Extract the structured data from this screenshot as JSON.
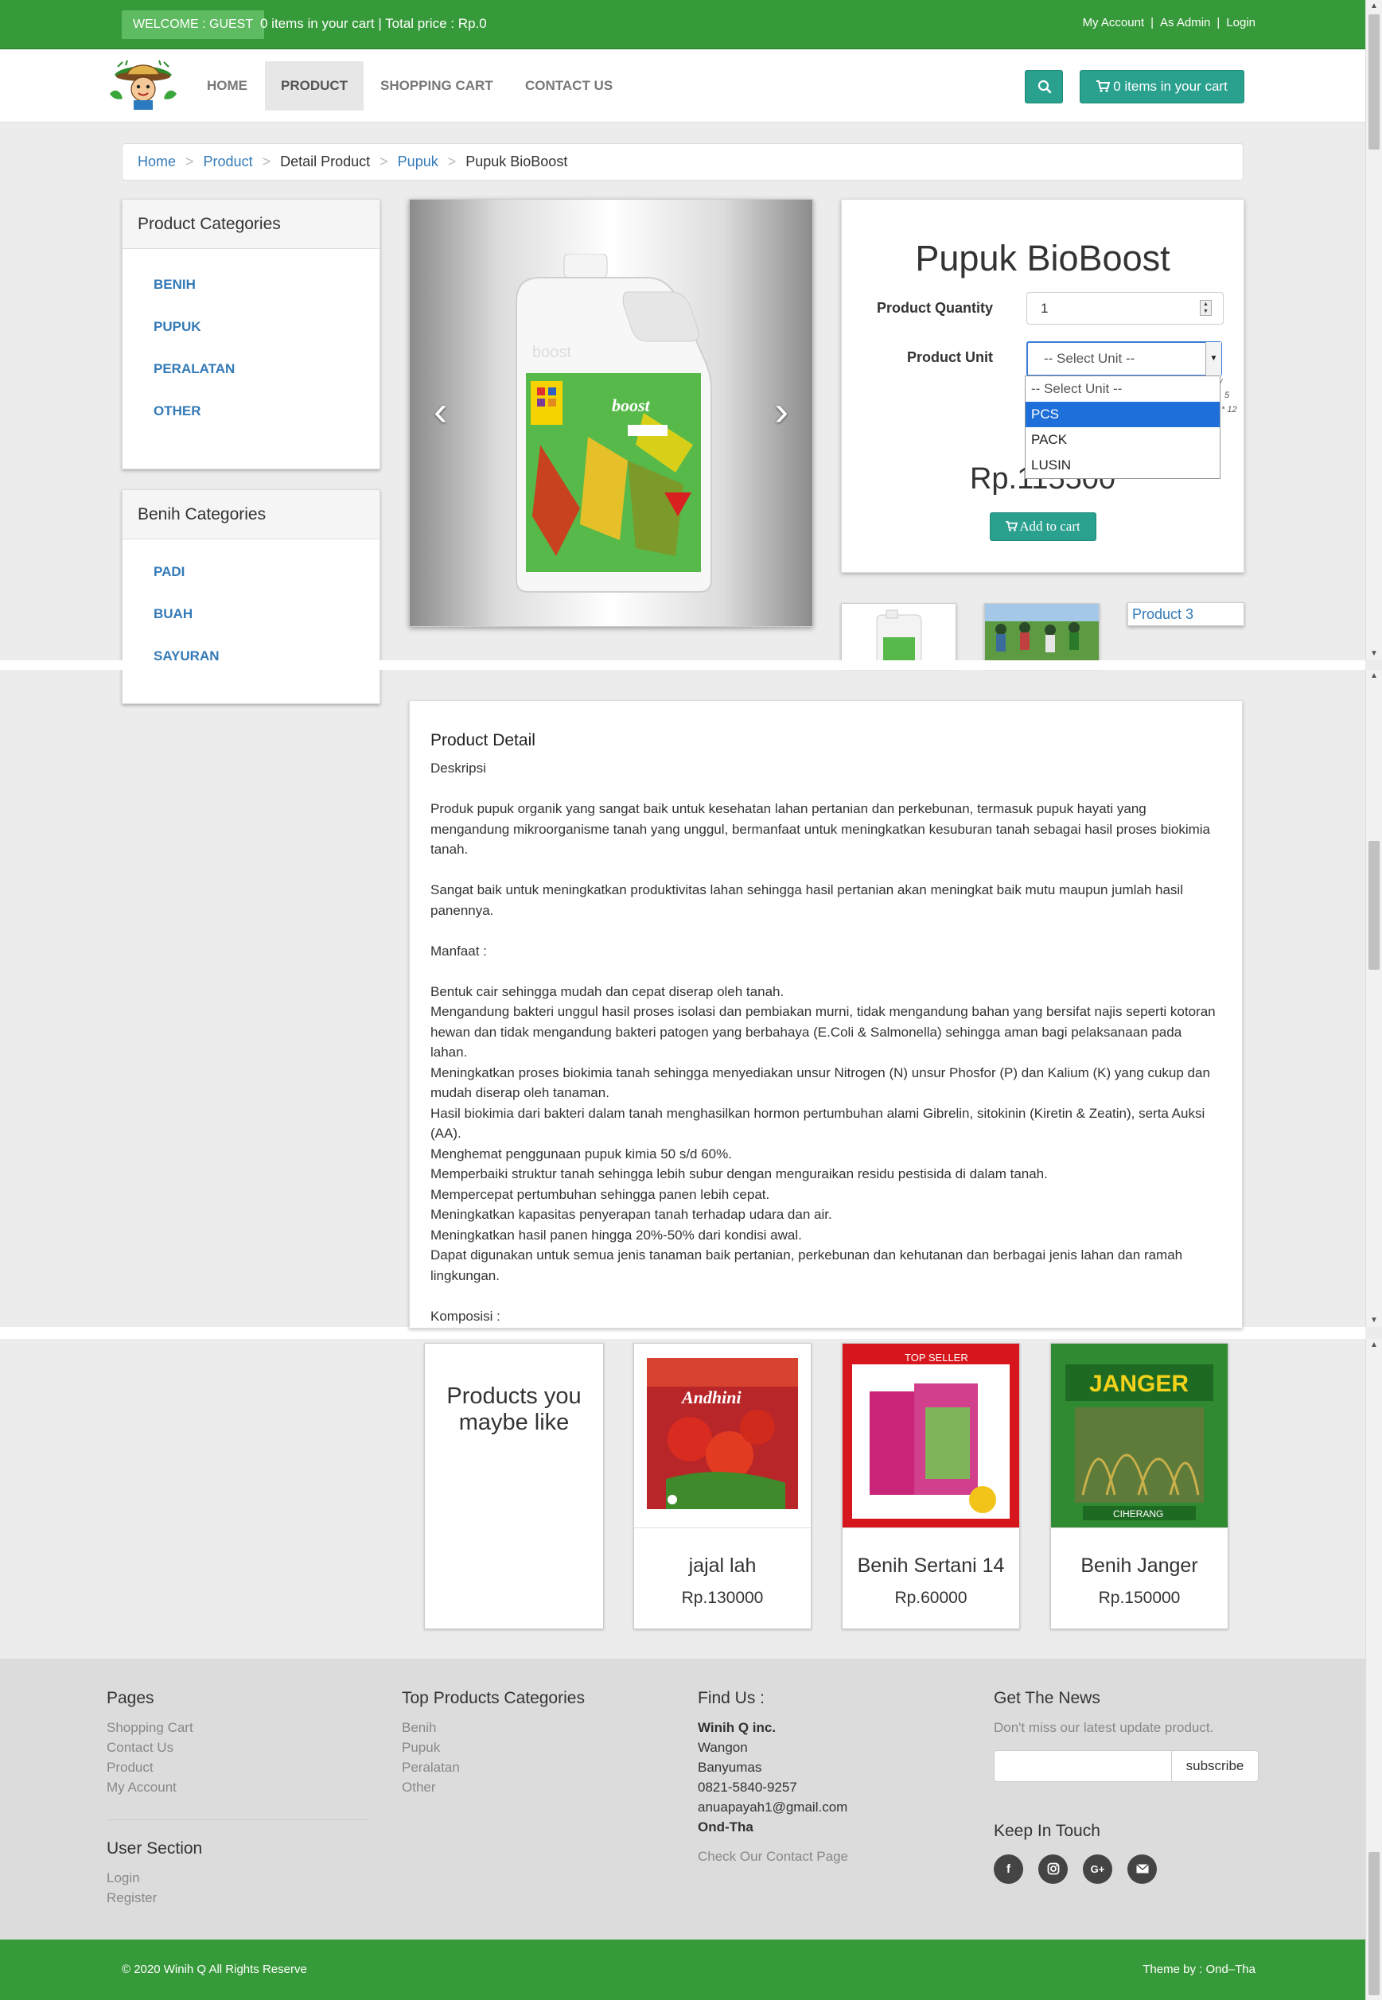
{
  "topbar": {
    "welcome": "WELCOME : GUEST",
    "cart_summary": "0 items in your cart | Total price : Rp.0",
    "links": [
      "My Account",
      "As Admin",
      "Login"
    ]
  },
  "nav": {
    "items": [
      "HOME",
      "PRODUCT",
      "SHOPPING CART",
      "CONTACT US"
    ],
    "active": "PRODUCT",
    "cart_button": "0 items in your cart",
    "search_icon": "search-icon",
    "cart_icon": "cart-icon"
  },
  "breadcrumb": [
    "Home",
    "Product",
    "Detail Product",
    "Pupuk",
    "Pupuk BioBoost"
  ],
  "product_categories": {
    "title": "Product Categories",
    "items": [
      "BENIH",
      "PUPUK",
      "PERALATAN",
      "OTHER"
    ]
  },
  "benih_categories": {
    "title": "Benih Categories",
    "items": [
      "PADI",
      "BUAH",
      "SAYURAN"
    ]
  },
  "product": {
    "name": "Pupuk BioBoost",
    "quantity_label": "Product Quantity",
    "quantity_value": "1",
    "unit_label": "Product Unit",
    "unit_selected": "-- Select Unit --",
    "unit_options": [
      "-- Select Unit --",
      "PCS",
      "PACK",
      "LUSIN"
    ],
    "unit_highlighted": "PCS",
    "price": "Rp.115500",
    "add_to_cart": "Add to cart",
    "thumb3_label": "Product 3"
  },
  "detail": {
    "heading": "Product Detail",
    "body": "Deskripsi\n\nProduk pupuk organik yang sangat baik untuk kesehatan lahan pertanian dan perkebunan, termasuk pupuk hayati yang mengandung mikroorganisme tanah yang unggul, bermanfaat untuk meningkatkan kesuburan tanah sebagai hasil proses biokimia tanah.\n\nSangat baik untuk meningkatkan produktivitas lahan sehingga hasil pertanian akan meningkat baik mutu maupun jumlah hasil panennya.\n\nManfaat :\n\nBentuk cair sehingga mudah dan cepat diserap oleh tanah.\nMengandung bakteri unggul hasil proses isolasi dan pembiakan murni, tidak mengandung bahan yang bersifat najis seperti kotoran hewan dan tidak mengandung bakteri patogen yang berbahaya (E.Coli & Salmonella) sehingga aman bagi pelaksanaan pada lahan.\nMeningkatkan proses biokimia tanah sehingga menyediakan unsur Nitrogen (N) unsur Phosfor (P) dan Kalium (K) yang cukup dan mudah diserap oleh tanaman.\nHasil biokimia dari bakteri dalam tanah menghasilkan hormon pertumbuhan alami Gibrelin, sitokinin (Kiretin & Zeatin), serta Auksi (AA).\nMenghemat penggunaan pupuk kimia 50 s/d 60%.\nMemperbaiki struktur tanah sehingga lebih subur dengan menguraikan residu pestisida di dalam tanah.\nMempercepat pertumbuhan sehingga panen lebih cepat.\nMeningkatkan kapasitas penyerapan tanah terhadap udara dan air.\nMeningkatkan hasil panen hingga 20%-50% dari kondisi awal.\nDapat digunakan untuk semua jenis tanaman baik pertanian, perkebunan dan kehutanan dan berbagai jenis lahan dan ramah lingkungan.\n\nKomposisi :"
  },
  "related": {
    "title": "Products you maybe like",
    "items": [
      {
        "name": "jajal lah",
        "price": "Rp.130000"
      },
      {
        "name": "Benih Sertani 14",
        "price": "Rp.60000"
      },
      {
        "name": "Benih Janger",
        "price": "Rp.150000"
      }
    ],
    "image_text": {
      "andhini": "Andhini",
      "top_seller": "TOP SELLER",
      "janger": "JANGER",
      "ciherang": "CIHERANG"
    }
  },
  "footer": {
    "pages": {
      "title": "Pages",
      "links": [
        "Shopping Cart",
        "Contact Us",
        "Product",
        "My Account"
      ]
    },
    "user": {
      "title": "User Section",
      "links": [
        "Login",
        "Register"
      ]
    },
    "top_categories": {
      "title": "Top Products Categories",
      "links": [
        "Benih",
        "Pupuk",
        "Peralatan",
        "Other"
      ]
    },
    "find_us": {
      "title": "Find Us :",
      "company": "Winih Q inc.",
      "lines": [
        "Wangon",
        "Banyumas",
        "0821-5840-9257",
        "anuapayah1@gmail.com"
      ],
      "owner": "Ond-Tha",
      "contact_link": "Check Our Contact Page"
    },
    "news": {
      "title": "Get The News",
      "text": "Don't miss our latest update product.",
      "button": "subscribe",
      "keep_title": "Keep In Touch",
      "social_icons": [
        "facebook-icon",
        "instagram-icon",
        "google-plus-icon",
        "email-icon"
      ]
    },
    "copyright": "© 2020 Winih Q All Rights Reserve",
    "theme": "Theme by : Ond–Tha"
  },
  "colors": {
    "brand_green": "#379a3a",
    "teal_button": "#2aa08f",
    "link_blue": "#337ab7",
    "select_blue": "#1e6fd9"
  }
}
